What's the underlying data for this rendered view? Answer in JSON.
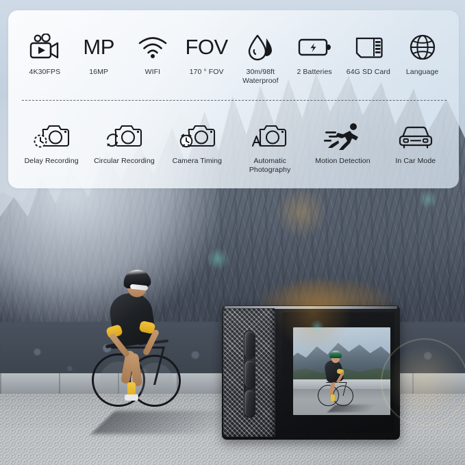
{
  "product": {
    "type": "action-camera-feature-panel",
    "scene_description": "Cyclist riding on mountain road with action camera displaying live preview"
  },
  "panel": {
    "specs_row": [
      {
        "icon": "video-camera-icon",
        "glyph": "",
        "label": "4K30FPS"
      },
      {
        "icon": "megapixel-text-icon",
        "glyph": "MP",
        "label": "16MP"
      },
      {
        "icon": "wifi-icon",
        "glyph": "",
        "label": "WIFI"
      },
      {
        "icon": "fov-text-icon",
        "glyph": "FOV",
        "label": "170 ° FOV"
      },
      {
        "icon": "water-drop-icon",
        "glyph": "",
        "label": "30m/98ft\nWaterproof"
      },
      {
        "icon": "battery-icon",
        "glyph": "",
        "label": "2 Batteries"
      },
      {
        "icon": "sd-card-icon",
        "glyph": "",
        "label": "64G SD Card"
      },
      {
        "icon": "globe-icon",
        "glyph": "",
        "label": "Language"
      }
    ],
    "modes_row": [
      {
        "icon": "camera-clock-icon",
        "label": "Delay Recording"
      },
      {
        "icon": "camera-loop-icon",
        "label": "Circular Recording"
      },
      {
        "icon": "camera-alarm-icon",
        "label": "Camera Timing"
      },
      {
        "icon": "camera-auto-icon",
        "label": "Automatic\nPhotography"
      },
      {
        "icon": "running-person-icon",
        "label": "Motion Detection"
      },
      {
        "icon": "car-icon",
        "label": "In Car Mode"
      }
    ]
  },
  "colors": {
    "panel_bg_start": "#ffffff",
    "panel_bg_end": "#d6e3ef",
    "icon_stroke": "#1b1e22",
    "label_text": "#2d3136",
    "divider": "#5d6672",
    "jersey_accent": "#f2c23a",
    "camera_body": "#131518"
  }
}
